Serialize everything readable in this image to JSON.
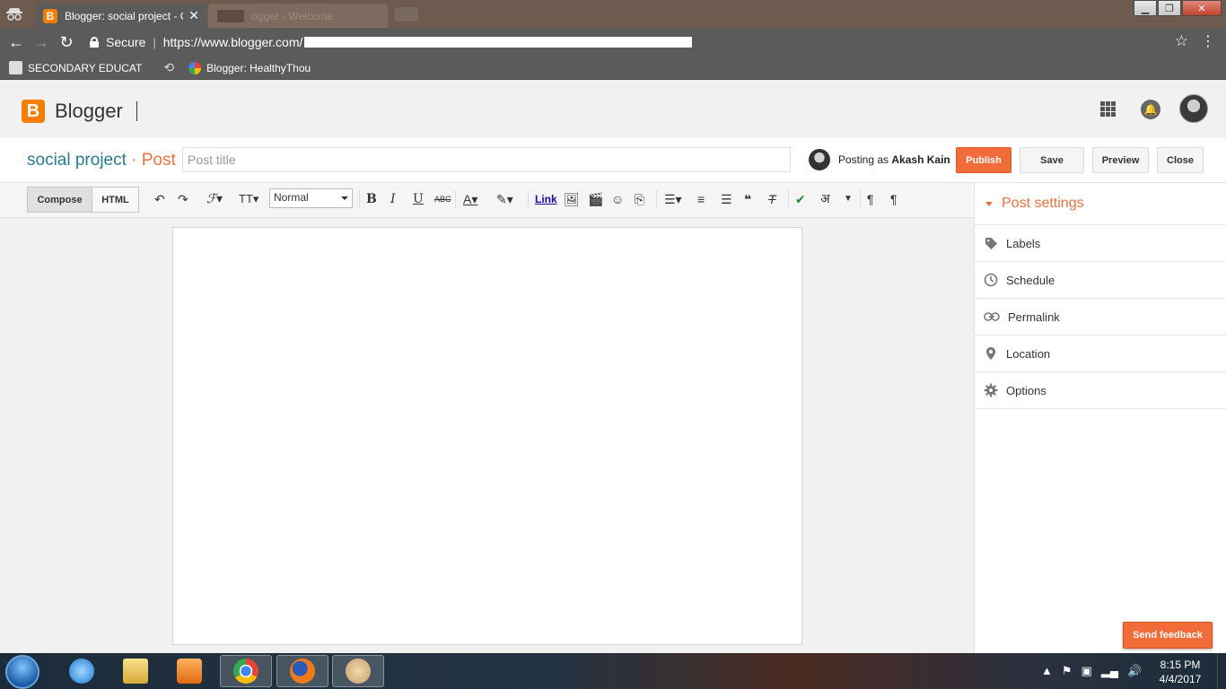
{
  "browser": {
    "active_tab_title": "Blogger: social project - C",
    "inactive_tab_title": "ogger - Welcome",
    "secure_label": "Secure",
    "url": "https://www.blogger.com/",
    "bookmarks": [
      {
        "label": "SECONDARY EDUCAT"
      },
      {
        "label": "Blogger: HealthyThou"
      }
    ]
  },
  "header": {
    "brand": "Blogger",
    "logo_letter": "B"
  },
  "post": {
    "blog_name": "social project",
    "separator": "·",
    "type": "Post",
    "title_placeholder": "Post title",
    "posting_as_prefix": "Posting as",
    "author": "Akash Kain",
    "buttons": {
      "publish": "Publish",
      "save": "Save",
      "preview": "Preview",
      "close": "Close"
    }
  },
  "toolbar": {
    "compose": "Compose",
    "html": "HTML",
    "format_value": "Normal",
    "link": "Link"
  },
  "sidebar": {
    "title": "Post settings",
    "items": [
      {
        "label": "Labels",
        "icon": "label-icon"
      },
      {
        "label": "Schedule",
        "icon": "clock-icon"
      },
      {
        "label": "Permalink",
        "icon": "link-icon"
      },
      {
        "label": "Location",
        "icon": "location-pin-icon"
      },
      {
        "label": "Options",
        "icon": "gear-icon"
      }
    ]
  },
  "feedback": "Send feedback",
  "taskbar": {
    "time": "8:15 PM",
    "date": "4/4/2017"
  },
  "colors": {
    "accent_orange": "#f26c3a",
    "blog_teal": "#2a7c8c",
    "logo_orange": "#f57d00"
  }
}
